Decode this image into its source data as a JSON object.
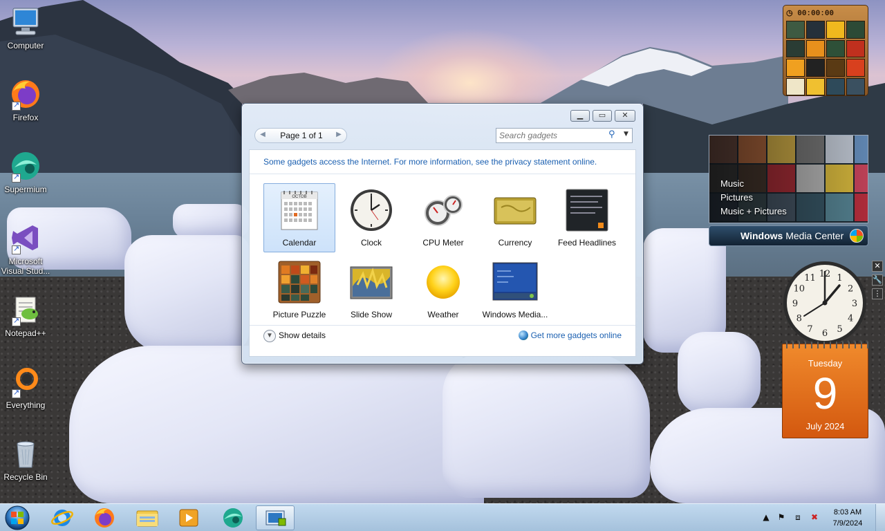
{
  "desktop": {
    "icons": [
      {
        "label": "Computer",
        "icon": "computer-icon"
      },
      {
        "label": "Firefox",
        "icon": "firefox-icon"
      },
      {
        "label": "Supermium",
        "icon": "supermium-icon"
      },
      {
        "label": "Microsoft Visual Stud...",
        "icon": "visual-studio-icon"
      },
      {
        "label": "Notepad++",
        "icon": "notepadpp-icon"
      },
      {
        "label": "Everything",
        "icon": "everything-icon"
      },
      {
        "label": "Recycle Bin",
        "icon": "recycle-bin-icon"
      }
    ]
  },
  "gallery": {
    "pager": "Page 1 of 1",
    "search_placeholder": "Search gadgets",
    "privacy_text": "Some gadgets access the Internet.  For more information, see the privacy statement online.",
    "gadgets": [
      {
        "label": "Calendar",
        "selected": true
      },
      {
        "label": "Clock"
      },
      {
        "label": "CPU Meter"
      },
      {
        "label": "Currency"
      },
      {
        "label": "Feed Headlines"
      },
      {
        "label": "Picture Puzzle"
      },
      {
        "label": "Slide Show"
      },
      {
        "label": "Weather"
      },
      {
        "label": "Windows Media..."
      }
    ],
    "show_details": "Show details",
    "get_more": "Get more gadgets online",
    "calendar_thumb_month": "OCTOB"
  },
  "sidebar": {
    "puzzle_timer": "00:00:00",
    "wmc": {
      "menu": [
        "Music",
        "Pictures",
        "Music + Pictures"
      ],
      "title_bold": "Windows",
      "title_rest": " Media Center"
    },
    "clock_numbers": [
      "12",
      "1",
      "2",
      "3",
      "4",
      "5",
      "6",
      "7",
      "8",
      "9",
      "10",
      "11"
    ],
    "calendar": {
      "weekday": "Tuesday",
      "day": "9",
      "month_year": "July 2024"
    }
  },
  "taskbar": {
    "time": "8:03 AM",
    "date": "7/9/2024",
    "pinned": [
      "internet-explorer-icon",
      "firefox-icon",
      "explorer-icon",
      "media-player-icon",
      "supermium-icon",
      "gadget-gallery-icon"
    ]
  }
}
